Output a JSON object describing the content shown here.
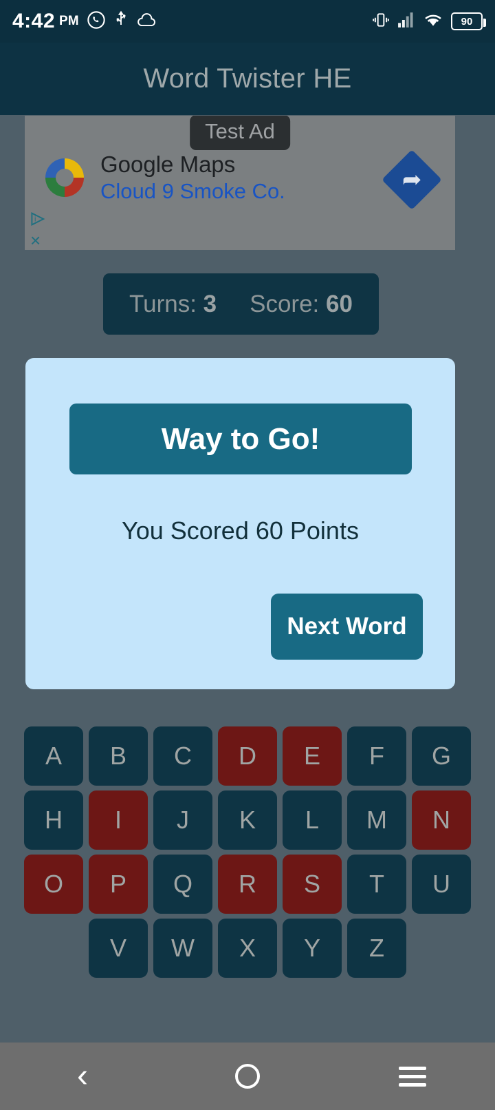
{
  "status_bar": {
    "time": "4:42",
    "ampm": "PM",
    "left_icons": [
      "whatsapp-icon",
      "usb-icon",
      "cloud-icon"
    ],
    "right_icons": [
      "vibrate-icon",
      "signal-icon",
      "wifi-icon"
    ],
    "battery_level": "90"
  },
  "app_bar": {
    "title": "Word Twister HE"
  },
  "ad": {
    "badge": "Test Ad",
    "advertiser": "Google Maps",
    "headline": "Cloud 9 Smoke Co.",
    "nav_glyph": "➦",
    "adchoices_glyph": "▷",
    "close_glyph": "×"
  },
  "game_status": {
    "turns_label": "Turns:",
    "turns_value": "3",
    "score_label": "Score:",
    "score_value": "60"
  },
  "dialog": {
    "header": "Way to Go!",
    "message": "You Scored 60 Points",
    "action_label": "Next Word"
  },
  "keyboard": {
    "rows": [
      [
        {
          "letter": "A",
          "state": "available"
        },
        {
          "letter": "B",
          "state": "available"
        },
        {
          "letter": "C",
          "state": "available"
        },
        {
          "letter": "D",
          "state": "used"
        },
        {
          "letter": "E",
          "state": "used"
        },
        {
          "letter": "F",
          "state": "available"
        },
        {
          "letter": "G",
          "state": "available"
        }
      ],
      [
        {
          "letter": "H",
          "state": "available"
        },
        {
          "letter": "I",
          "state": "used"
        },
        {
          "letter": "J",
          "state": "available"
        },
        {
          "letter": "K",
          "state": "available"
        },
        {
          "letter": "L",
          "state": "available"
        },
        {
          "letter": "M",
          "state": "available"
        },
        {
          "letter": "N",
          "state": "used"
        }
      ],
      [
        {
          "letter": "O",
          "state": "used"
        },
        {
          "letter": "P",
          "state": "used"
        },
        {
          "letter": "Q",
          "state": "available"
        },
        {
          "letter": "R",
          "state": "used"
        },
        {
          "letter": "S",
          "state": "used"
        },
        {
          "letter": "T",
          "state": "available"
        },
        {
          "letter": "U",
          "state": "available"
        }
      ],
      [
        {
          "letter": "V",
          "state": "available"
        },
        {
          "letter": "W",
          "state": "available"
        },
        {
          "letter": "X",
          "state": "available"
        },
        {
          "letter": "Y",
          "state": "available"
        },
        {
          "letter": "Z",
          "state": "available"
        }
      ]
    ]
  },
  "nav_bar": {
    "back": "back-icon",
    "home": "home-icon",
    "recents": "recents-icon"
  },
  "colors": {
    "app_bar": "#0d3243",
    "accent_teal": "#186a84",
    "dialog_bg": "#c4e5fb",
    "tile_available": "#0e3444",
    "tile_used": "#6d1715",
    "scrim": "#4f5f69",
    "nav_bar": "#6e6e6e"
  }
}
